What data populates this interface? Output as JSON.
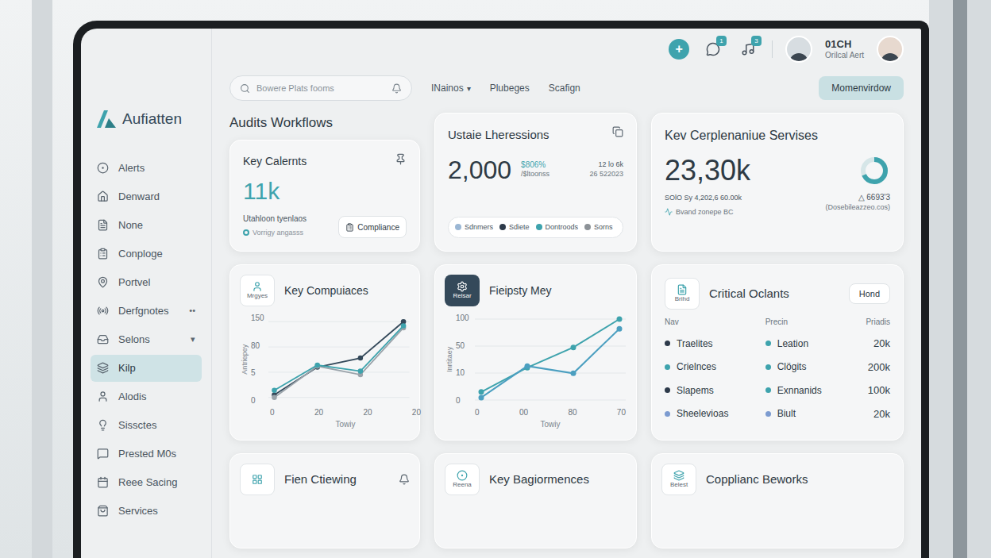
{
  "app": {
    "logo": "Aufiatten"
  },
  "search": {
    "placeholder": "Bowere Plats fooms"
  },
  "nav": [
    {
      "label": "INainos",
      "caret": "▾"
    },
    {
      "label": "Plubeges"
    },
    {
      "label": "Scafign"
    }
  ],
  "actions": [
    {
      "kind": "add",
      "label": "+"
    },
    {
      "kind": "chat",
      "badge": "1"
    },
    {
      "kind": "music",
      "badge": "3"
    }
  ],
  "user": {
    "name": "01CH",
    "role": "Orilcal Aert"
  },
  "primary_button": "Momenvirdow",
  "sidebar": {
    "items": [
      {
        "label": "Alerts",
        "selected": false
      },
      {
        "label": "Denward",
        "selected": false
      },
      {
        "label": "None",
        "selected": false
      },
      {
        "label": "Conploge",
        "selected": false
      },
      {
        "label": "Portvel",
        "selected": false
      },
      {
        "label": "Derfgnotes",
        "selected": false,
        "suffix": "••"
      },
      {
        "label": "Selons",
        "selected": false,
        "suffix": "▾"
      },
      {
        "label": "Kilp",
        "selected": true
      },
      {
        "label": "Alodis",
        "selected": false
      },
      {
        "label": "Sissctes",
        "selected": false
      },
      {
        "label": "Prested M0s",
        "selected": false
      },
      {
        "label": "Reee Sacing",
        "selected": false
      },
      {
        "label": "Services",
        "selected": false
      }
    ]
  },
  "page_title": "Audits Workflows",
  "key_calernts": {
    "title": "Key Calernts",
    "value": "11k",
    "subtitle": "Utahloon tyenlaos",
    "note": "Vorrigy angasss",
    "button": "Compliance"
  },
  "ustaie": {
    "title": "Ustaie Lheressions",
    "value": "2,000",
    "change": "$806%",
    "change_sub": "/$ltoonss",
    "side_top": "12 lo 6k",
    "side_bottom": "26 522023",
    "legend": [
      {
        "label": "Sdnmers",
        "color": "#9bb7d4"
      },
      {
        "label": "Sdiete",
        "color": "#2d3a4a"
      },
      {
        "label": "Dontroods",
        "color": "#3ea3ad"
      },
      {
        "label": "Sorns",
        "color": "#8c9297"
      }
    ]
  },
  "servises": {
    "title": "Kev Cerplenaniue Servises",
    "value": "23,30k",
    "delta": "△ 6693'3",
    "delta_note": "(Dosebileazzeo.cos)",
    "footer": "SOlO Sy 4,202,6 60.00k",
    "footer_note": "Bvand zonepe BC"
  },
  "compuiaces_chart": {
    "title": "Key Compuiaces",
    "icon_label": "Mrgyes",
    "y_label": "Antriepey",
    "y_ticks": [
      "150",
      "80",
      "5",
      "0"
    ],
    "x_ticks": [
      "0",
      "20",
      "20",
      "20"
    ],
    "x_label": "Towiy",
    "series": [
      {
        "values": [
          5,
          60,
          78,
          150
        ],
        "color": "#34495a"
      },
      {
        "values": [
          0,
          62,
          45,
          138
        ],
        "color": "#9aa3aa"
      },
      {
        "values": [
          14,
          64,
          52,
          142
        ],
        "color": "#3ea3ad"
      }
    ]
  },
  "mey_chart": {
    "title": "Fieipsty Mey",
    "icon_label": "Relsar",
    "y_label": "Inrtitaey",
    "y_ticks": [
      "100",
      "50",
      "10",
      "0"
    ],
    "x_ticks": [
      "0",
      "00",
      "80",
      "70"
    ],
    "x_label": "Towiy",
    "series": [
      {
        "values": [
          10,
          40,
          65,
          100
        ],
        "color": "#3ea3ad"
      },
      {
        "values": [
          3,
          42,
          33,
          88
        ],
        "color": "#4b9fc0"
      }
    ]
  },
  "critical": {
    "title": "Critical Oclants",
    "icon_label": "Brihd",
    "button": "Hond",
    "columns": [
      "Nav",
      "Precin",
      "Priadis"
    ],
    "rows": [
      {
        "nav": "Traelites",
        "nav_color": "#2d3a4a",
        "precin": "Leation",
        "precin_color": "#3ea3ad",
        "priadis": "20k"
      },
      {
        "nav": "Crielnces",
        "nav_color": "#3ea3ad",
        "precin": "Clögits",
        "precin_color": "#3ea3ad",
        "priadis": "200k"
      },
      {
        "nav": "Slapems",
        "nav_color": "#2d3a4a",
        "precin": "Exnnanids",
        "precin_color": "#3ea3ad",
        "priadis": "100k"
      },
      {
        "nav": "Sheelevioas",
        "nav_color": "#7c9bd0",
        "precin": "Biult",
        "precin_color": "#7c9bd0",
        "priadis": "20k"
      }
    ]
  },
  "bottom_cards": [
    {
      "title": "Fien Ctiewing"
    },
    {
      "title": "Key Bagiormences",
      "icon_label": "Reena"
    },
    {
      "title": "Copplianc Beworks",
      "icon_label": "Belest"
    }
  ]
}
